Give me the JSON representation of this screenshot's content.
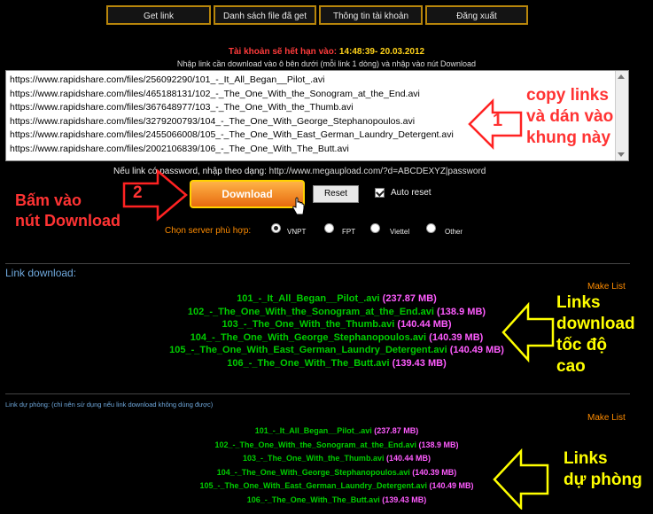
{
  "nav": {
    "items": [
      "Get link",
      "Danh sách file đã get",
      "Thông tin tài khoản",
      "Đăng xuất"
    ]
  },
  "account": {
    "expire_label": "Tài khoản sẽ hết hạn vào:",
    "expire_value": "14:48:39- 20.03.2012",
    "instructions": "Nhập link cần download vào ô bên dưới (mỗi link 1 dòng) và nhập vào nút Download"
  },
  "input": {
    "links": [
      "https://www.rapidshare.com/files/256092290/101_-_It_All_Began__Pilot_.avi",
      "https://www.rapidshare.com/files/465188131/102_-_The_One_With_the_Sonogram_at_the_End.avi",
      "https://www.rapidshare.com/files/367648977/103_-_The_One_With_the_Thumb.avi",
      "https://www.rapidshare.com/files/3279200793/104_-_The_One_With_George_Stephanopoulos.avi",
      "https://www.rapidshare.com/files/2455066008/105_-_The_One_With_East_German_Laundry_Detergent.avi",
      "https://www.rapidshare.com/files/2002106839/106_-_The_One_With_The_Butt.avi"
    ],
    "password_hint": "Nếu link có password, nhập theo dạng:",
    "password_example": "http://www.megaupload.com/?d=ABCDEXYZ|password"
  },
  "actions": {
    "download": "Download",
    "reset": "Reset",
    "auto_reset": "Auto reset",
    "auto_reset_checked": true
  },
  "server": {
    "label": "Chọn server phù hợp:",
    "options": [
      "VNPT",
      "FPT",
      "Viettel",
      "Other"
    ],
    "selected": "VNPT"
  },
  "results": {
    "title": "Link download:",
    "make_list": "Make List",
    "items": [
      {
        "name": "101_-_It_All_Began__Pilot_.avi",
        "size": "(237.87 MB)"
      },
      {
        "name": "102_-_The_One_With_the_Sonogram_at_the_End.avi",
        "size": "(138.9 MB)"
      },
      {
        "name": "103_-_The_One_With_the_Thumb.avi",
        "size": "(140.44 MB)"
      },
      {
        "name": "104_-_The_One_With_George_Stephanopoulos.avi",
        "size": "(140.39 MB)"
      },
      {
        "name": "105_-_The_One_With_East_German_Laundry_Detergent.avi",
        "size": "(140.49 MB)"
      },
      {
        "name": "106_-_The_One_With_The_Butt.avi",
        "size": "(139.43 MB)"
      }
    ]
  },
  "backup": {
    "title": "Link dự phòng: (chỉ nên sử dụng nếu link download không dùng được)",
    "make_list": "Make List",
    "items": [
      {
        "name": "101_-_It_All_Began__Pilot_.avi",
        "size": "(237.87 MB)"
      },
      {
        "name": "102_-_The_One_With_the_Sonogram_at_the_End.avi",
        "size": "(138.9 MB)"
      },
      {
        "name": "103_-_The_One_With_the_Thumb.avi",
        "size": "(140.44 MB)"
      },
      {
        "name": "104_-_The_One_With_George_Stephanopoulos.avi",
        "size": "(140.39 MB)"
      },
      {
        "name": "105_-_The_One_With_East_German_Laundry_Detergent.avi",
        "size": "(140.49 MB)"
      },
      {
        "name": "106_-_The_One_With_The_Butt.avi",
        "size": "(139.43 MB)"
      }
    ]
  },
  "annotations": {
    "step1_number": "1",
    "step1_text": [
      "copy links",
      "và dán vào",
      "khung này"
    ],
    "step2_number": "2",
    "step2_text": [
      "Bấm vào",
      "nút Download"
    ],
    "links_fast": [
      "Links",
      "download",
      "tốc độ",
      "cao"
    ],
    "links_backup": [
      "Links",
      "dự phòng"
    ]
  },
  "colors": {
    "background": "#000000",
    "nav_border": "#b8860b",
    "filename": "#00cc00",
    "filesize": "#ff5cff",
    "accent_orange": "#ff8c00",
    "annotation_red": "#ff3333",
    "annotation_yellow": "#ffff00",
    "section_blue": "#6fa8dc"
  }
}
